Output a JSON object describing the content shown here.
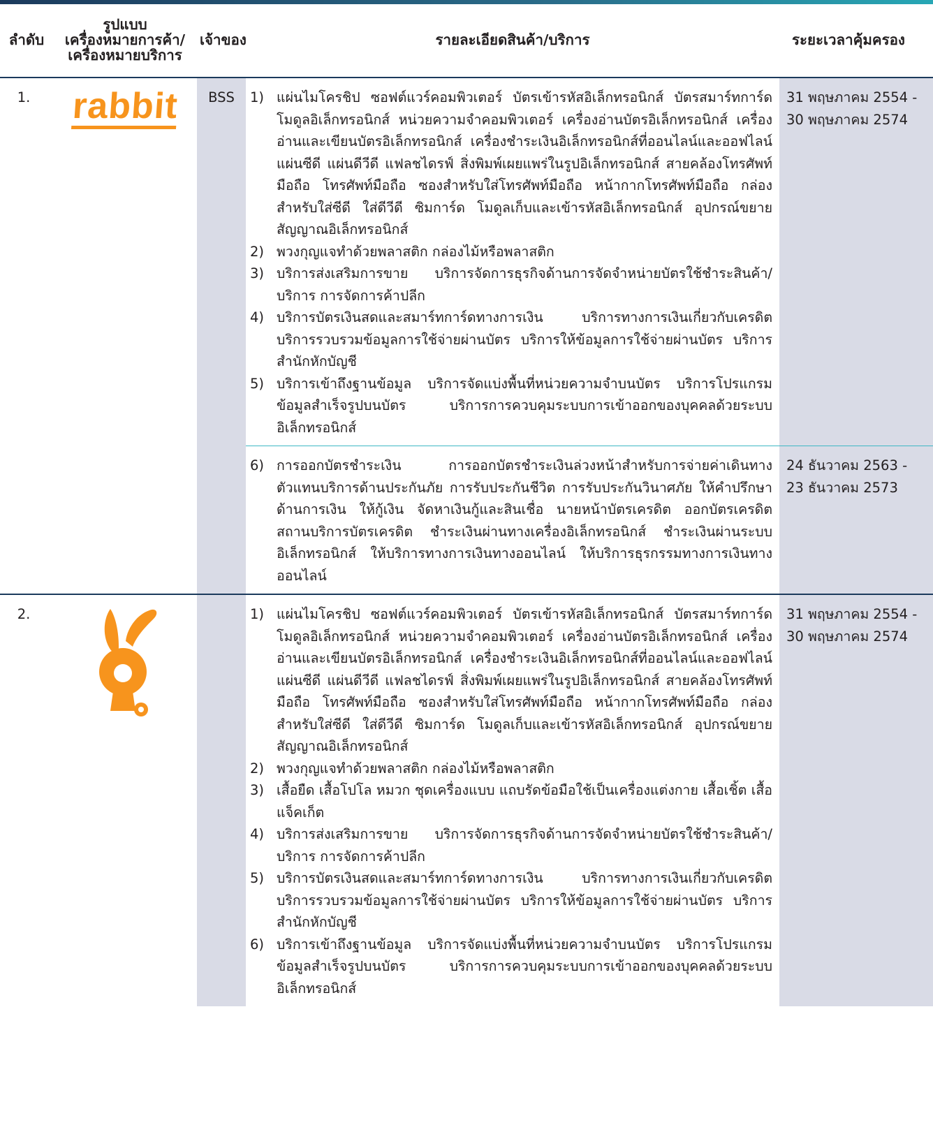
{
  "headers": {
    "no": "ลำดับ",
    "mark": [
      "รูปแบบ",
      "เครื่องหมายการค้า/",
      "เครื่องหมายบริการ"
    ],
    "owner": "เจ้าของ",
    "detail": "รายละเอียดสินค้า/บริการ",
    "period": "ระยะเวลาคุ้มครอง"
  },
  "colors": {
    "accent": "#f7941d",
    "shade": "#d9dbe6",
    "rule": "#1b3a5c",
    "teal_rule": "#3eb8c4"
  },
  "rows": [
    {
      "no": "1.",
      "logo": {
        "type": "wordmark",
        "text": "rabbit"
      },
      "owner": "BSS",
      "blocks": [
        {
          "items": [
            {
              "n": "1)",
              "t": "แผ่นไมโครชิป ซอฟต์แวร์คอมพิวเตอร์ บัตรเข้ารหัสอิเล็กทรอนิกส์ บัตรสมาร์ทการ์ด โมดูลอิเล็กทรอนิกส์ หน่วยความจำคอมพิวเตอร์ เครื่องอ่านบัตรอิเล็กทรอนิกส์ เครื่องอ่านและเขียนบัตรอิเล็กทรอนิกส์ เครื่องชำระเงินอิเล็กทรอนิกส์ที่ออนไลน์และออฟไลน์ แผ่นซีดี แผ่นดีวีดี แฟลชไดรฟ์ สิ่งพิมพ์เผยแพร่ในรูปอิเล็กทรอนิกส์ สายคล้องโทรศัพท์มือถือ โทรศัพท์มือถือ ซองสำหรับใส่โทรศัพท์มือถือ หน้ากากโทรศัพท์มือถือ กล่องสำหรับใส่ซีดี ใส่ดีวีดี ซิมการ์ด โมดูลเก็บและเข้ารหัสอิเล็กทรอนิกส์ อุปกรณ์ขยายสัญญาณอิเล็กทรอนิกส์"
            },
            {
              "n": "2)",
              "t": "พวงกุญแจทำด้วยพลาสติก กล่องไม้หรือพลาสติก"
            },
            {
              "n": "3)",
              "t": "บริการส่งเสริมการขาย บริการจัดการธุรกิจด้านการจัดจำหน่ายบัตรใช้ชำระสินค้า/บริการ การจัดการค้าปลีก"
            },
            {
              "n": "4)",
              "t": "บริการบัตรเงินสดและสมาร์ทการ์ดทางการเงิน บริการทางการเงินเกี่ยวกับเครดิต บริการรวบรวมข้อมูลการใช้จ่ายผ่านบัตร บริการให้ข้อมูลการใช้จ่ายผ่านบัตร บริการสำนักหักบัญชี"
            },
            {
              "n": "5)",
              "t": "บริการเข้าถึงฐานข้อมูล บริการจัดแบ่งพื้นที่หน่วยความจำบนบัตร บริการโปรแกรมข้อมูลสำเร็จรูปบนบัตร บริการการควบคุมระบบการเข้าออกของบุคคลด้วยระบบอิเล็กทรอนิกส์"
            }
          ],
          "period": [
            "31 พฤษภาคม 2554 -",
            "30 พฤษภาคม 2574"
          ]
        },
        {
          "items": [
            {
              "n": "6)",
              "t": "การออกบัตรชำระเงิน การออกบัตรชำระเงินล่วงหน้าสำหรับการจ่ายค่าเดินทาง ตัวแทนบริการด้านประกันภัย การรับประกันชีวิต การรับประกันวินาศภัย ให้คำปรึกษาด้านการเงิน ให้กู้เงิน จัดหาเงินกู้และสินเชื่อ นายหน้าบัตรเครดิต ออกบัตรเครดิต สถานบริการบัตรเครดิต ชำระเงินผ่านทางเครื่องอิเล็กทรอนิกส์ ชำระเงินผ่านระบบอิเล็กทรอนิกส์ ให้บริการทางการเงินทางออนไลน์ ให้บริการธุรกรรมทางการเงินทางออนไลน์"
            }
          ],
          "period": [
            "24 ธันวาคม 2563 -",
            "23 ธันวาคม 2573"
          ]
        }
      ]
    },
    {
      "no": "2.",
      "logo": {
        "type": "rabbit-figure",
        "icon": "orange-rabbit-mascot"
      },
      "owner": "",
      "blocks": [
        {
          "items": [
            {
              "n": "1)",
              "t": "แผ่นไมโครชิป ซอฟต์แวร์คอมพิวเตอร์ บัตรเข้ารหัสอิเล็กทรอนิกส์ บัตรสมาร์ทการ์ด โมดูลอิเล็กทรอนิกส์ หน่วยความจำคอมพิวเตอร์ เครื่องอ่านบัตรอิเล็กทรอนิกส์ เครื่องอ่านและเขียนบัตรอิเล็กทรอนิกส์ เครื่องชำระเงินอิเล็กทรอนิกส์ที่ออนไลน์และออฟไลน์ แผ่นซีดี แผ่นดีวีดี แฟลชไดรฟ์ สิ่งพิมพ์เผยแพร่ในรูปอิเล็กทรอนิกส์ สายคล้องโทรศัพท์มือถือ โทรศัพท์มือถือ ซองสำหรับใส่โทรศัพท์มือถือ หน้ากากโทรศัพท์มือถือ กล่องสำหรับใส่ซีดี ใส่ดีวีดี ซิมการ์ด โมดูลเก็บและเข้ารหัสอิเล็กทรอนิกส์ อุปกรณ์ขยายสัญญาณอิเล็กทรอนิกส์"
            },
            {
              "n": "2)",
              "t": "พวงกุญแจทำด้วยพลาสติก กล่องไม้หรือพลาสติก"
            },
            {
              "n": "3)",
              "t": "เสื้อยืด เสื้อโปโล หมวก ชุดเครื่องแบบ แถบรัดข้อมือใช้เป็นเครื่องแต่งกาย เสื้อเชิ้ต เสื้อแจ็คเก็ต"
            },
            {
              "n": "4)",
              "t": "บริการส่งเสริมการขาย บริการจัดการธุรกิจด้านการจัดจำหน่ายบัตรใช้ชำระสินค้า/บริการ การจัดการค้าปลีก"
            },
            {
              "n": "5)",
              "t": "บริการบัตรเงินสดและสมาร์ทการ์ดทางการเงิน บริการทางการเงินเกี่ยวกับเครดิต บริการรวบรวมข้อมูลการใช้จ่ายผ่านบัตร บริการให้ข้อมูลการใช้จ่ายผ่านบัตร บริการสำนักหักบัญชี"
            },
            {
              "n": "6)",
              "t": "บริการเข้าถึงฐานข้อมูล บริการจัดแบ่งพื้นที่หน่วยความจำบนบัตร บริการโปรแกรมข้อมูลสำเร็จรูปบนบัตร บริการการควบคุมระบบการเข้าออกของบุคคลด้วยระบบอิเล็กทรอนิกส์"
            }
          ],
          "period": [
            "31 พฤษภาคม 2554 -",
            "30 พฤษภาคม 2574"
          ]
        }
      ]
    }
  ]
}
